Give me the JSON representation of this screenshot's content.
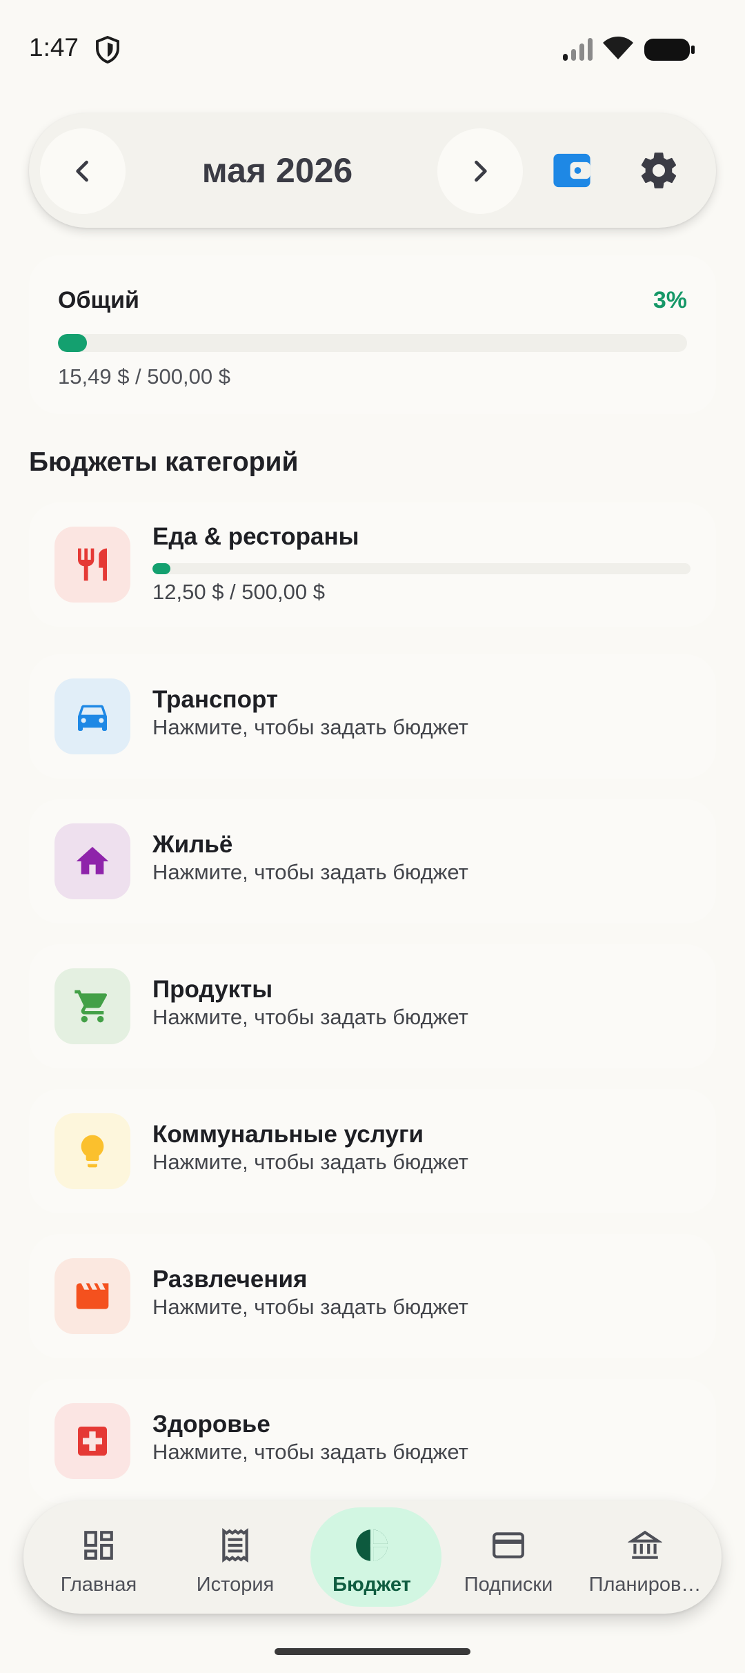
{
  "status_bar": {
    "time": "1:47"
  },
  "header": {
    "month": "мая 2026",
    "prev_icon": "chevron-left-icon",
    "next_icon": "chevron-right-icon",
    "wallet_icon": "wallet-icon",
    "settings_icon": "gear-icon"
  },
  "overall": {
    "label": "Общий",
    "percent": "3%",
    "progress_fraction": 0.03,
    "amount": "15,49 $ / 500,00 $"
  },
  "section_title": "Бюджеты категорий",
  "categories": [
    {
      "name": "Еда & рестораны",
      "amount": "12,50 $ / 500,00 $",
      "progress_fraction": 0.03,
      "icon": "restaurant-icon",
      "color": "#e53935",
      "bg": "#fbe5e1"
    },
    {
      "name": "Транспорт",
      "subtitle": "Нажмите, чтобы задать бюджет",
      "icon": "car-icon",
      "color": "#1e88e5",
      "bg": "#e1eef8"
    },
    {
      "name": "Жильё",
      "subtitle": "Нажмите, чтобы задать бюджет",
      "icon": "home-icon",
      "color": "#8e24aa",
      "bg": "#eee0ee"
    },
    {
      "name": "Продукты",
      "subtitle": "Нажмите, чтобы задать бюджет",
      "icon": "cart-icon",
      "color": "#43a047",
      "bg": "#e4f0e1"
    },
    {
      "name": "Коммунальные услуги",
      "subtitle": "Нажмите, чтобы задать бюджет",
      "icon": "lightbulb-icon",
      "color": "#fbc02d",
      "bg": "#fdf6dc"
    },
    {
      "name": "Развлечения",
      "subtitle": "Нажмите, чтобы задать бюджет",
      "icon": "movie-icon",
      "color": "#f4511e",
      "bg": "#fbe8e0"
    },
    {
      "name": "Здоровье",
      "subtitle": "Нажмите, чтобы задать бюджет",
      "icon": "medical-icon",
      "color": "#e53935",
      "bg": "#fbe5e3"
    }
  ],
  "nav": [
    {
      "label": "Главная",
      "icon": "dashboard-icon"
    },
    {
      "label": "История",
      "icon": "receipt-icon"
    },
    {
      "label": "Бюджет",
      "icon": "pie-chart-icon",
      "active": true
    },
    {
      "label": "Подписки",
      "icon": "card-icon"
    },
    {
      "label": "Планиров…",
      "icon": "bank-icon"
    }
  ],
  "colors": {
    "accent": "#14a06f",
    "active_nav_bg": "#d2f6e2",
    "background": "#faf9f5"
  }
}
